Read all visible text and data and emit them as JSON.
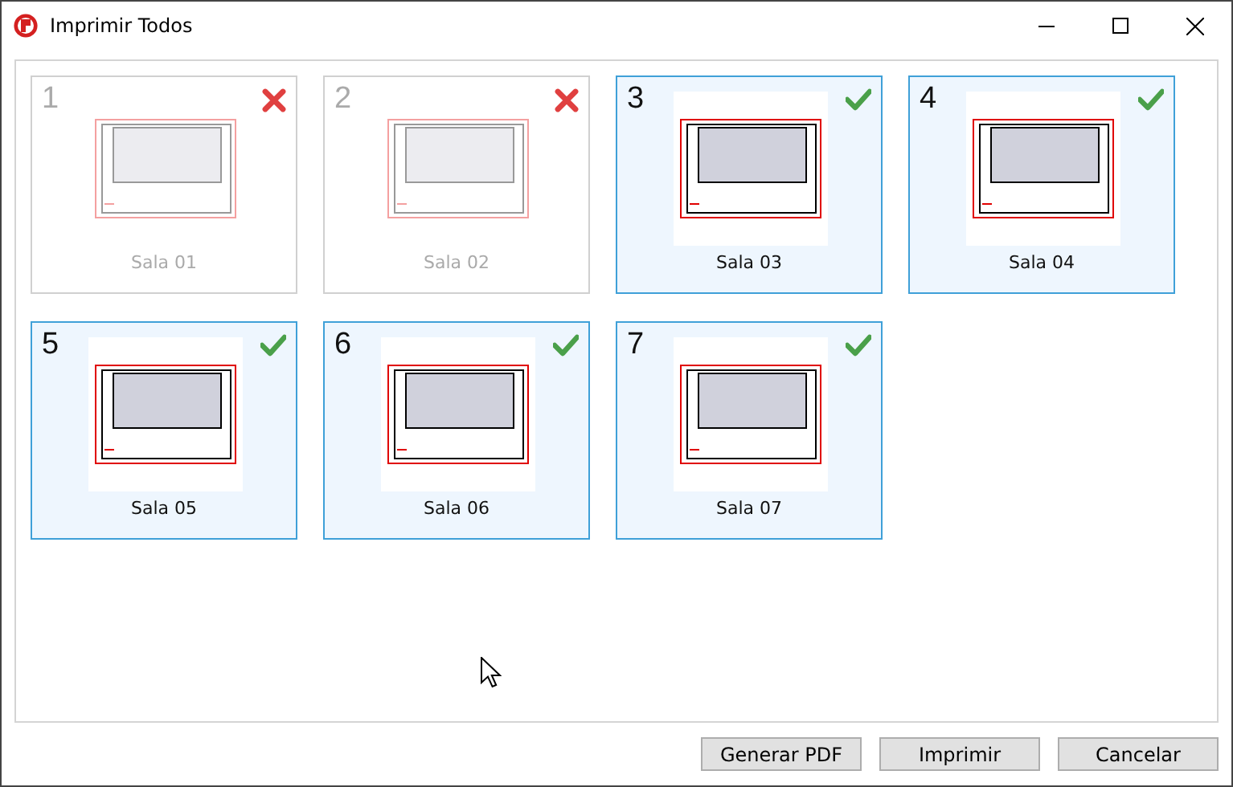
{
  "window": {
    "title": "Imprimir Todos"
  },
  "pages": [
    {
      "number": "1",
      "label": "Sala 01",
      "selected": false
    },
    {
      "number": "2",
      "label": "Sala 02",
      "selected": false
    },
    {
      "number": "3",
      "label": "Sala 03",
      "selected": true
    },
    {
      "number": "4",
      "label": "Sala 04",
      "selected": true
    },
    {
      "number": "5",
      "label": "Sala 05",
      "selected": true
    },
    {
      "number": "6",
      "label": "Sala 06",
      "selected": true
    },
    {
      "number": "7",
      "label": "Sala 07",
      "selected": true
    }
  ],
  "buttons": [
    "Generar PDF",
    "Imprimir",
    "Cancelar"
  ]
}
